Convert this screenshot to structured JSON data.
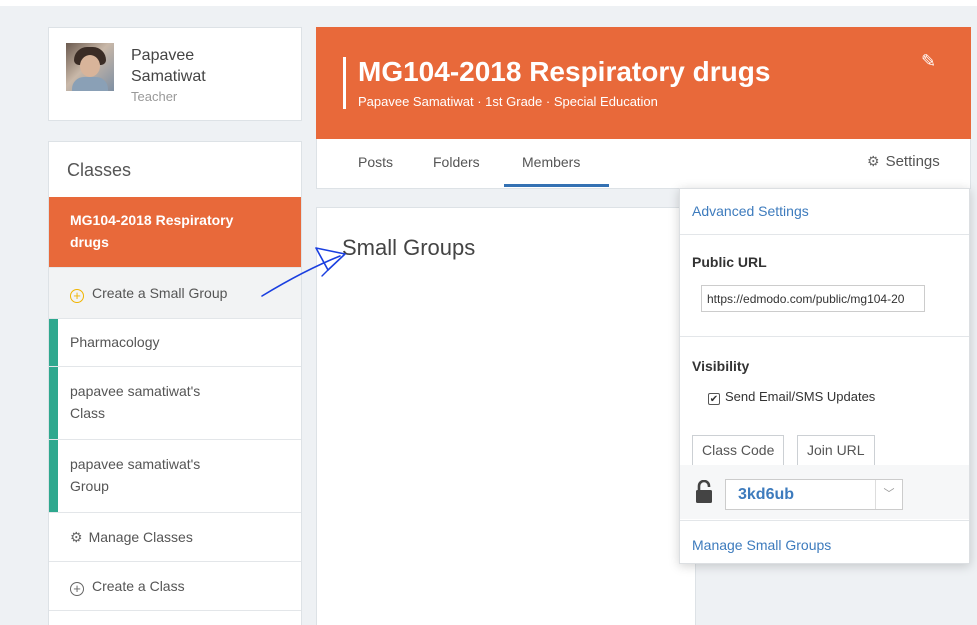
{
  "profile": {
    "name": "Papavee Samatiwat",
    "role": "Teacher"
  },
  "sidebar": {
    "title": "Classes",
    "active_class": "MG104-2018 Respiratory drugs",
    "create_small_group": "Create a Small Group",
    "groups": [
      {
        "label": "Pharmacology"
      },
      {
        "label": "papavee samatiwat's Class"
      },
      {
        "label": "papavee samatiwat's Group"
      }
    ],
    "manage_classes": "Manage Classes",
    "create_class": "Create a Class"
  },
  "header": {
    "title": "MG104-2018 Respiratory drugs",
    "subtitle": "Papavee Samatiwat · 1st Grade · Special Education"
  },
  "tabs": {
    "posts": "Posts",
    "folders": "Folders",
    "members": "Members",
    "settings": "Settings"
  },
  "main": {
    "title": "Small Groups"
  },
  "dropdown": {
    "advanced_settings": "Advanced Settings",
    "public_url_label": "Public URL",
    "public_url_value": "https://edmodo.com/public/mg104-20",
    "visibility_label": "Visibility",
    "send_updates": "Send Email/SMS Updates",
    "tab_class_code": "Class Code",
    "tab_join_url": "Join URL",
    "class_code": "3kd6ub",
    "manage_small_groups": "Manage Small Groups"
  },
  "colors": {
    "accent": "#e8693a",
    "link": "#3d7bbd",
    "group_bar": "#2ea88e",
    "annotation": "#1a3fe0"
  }
}
